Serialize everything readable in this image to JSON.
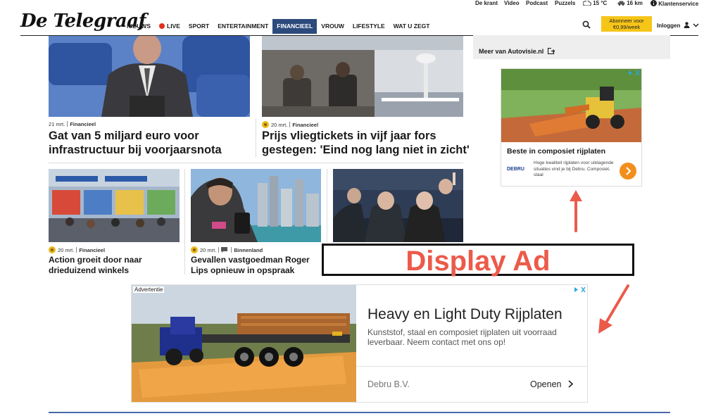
{
  "utility": {
    "items": [
      "De krant",
      "Video",
      "Podcast",
      "Puzzels"
    ],
    "weather": "15 °C",
    "traffic": "16 km",
    "service": "Klantenservice"
  },
  "header": {
    "logo": "De Telegraaf",
    "nav": [
      "NIEUWS",
      "LIVE",
      "SPORT",
      "ENTERTAINMENT",
      "FINANCIEEL",
      "VROUW",
      "LIFESTYLE",
      "WAT U ZEGT"
    ],
    "active_nav": "FINANCIEEL",
    "subscribe_line1": "Abonneer voor",
    "subscribe_line2": "€0,99/week",
    "login": "Inloggen"
  },
  "articles": [
    {
      "date": "21 mrt.",
      "category": "Financieel",
      "headline_1": "Gat van 5 miljard euro voor",
      "headline_2": "infrastructuur bij voorjaarsnota",
      "premium": false
    },
    {
      "date": "20 mrt.",
      "category": "Financieel",
      "headline_1": "Prijs vliegtickets in vijf jaar fors",
      "headline_2": "gestegen: 'Eind nog lang niet in zicht'",
      "premium": true
    },
    {
      "date": "20 mrt.",
      "category": "Financieel",
      "headline_1": "Action groeit door naar",
      "headline_2": "drieduizend winkels",
      "premium": true
    },
    {
      "date": "20 mrt.",
      "category": "Binnenland",
      "headline_1": "Gevallen vastgoedman Roger",
      "headline_2": "Lips opnieuw in opspraak",
      "premium": true,
      "has_comments": true
    }
  ],
  "sidebar": {
    "more_link": "Meer van Autovisie.nl",
    "ad": {
      "title": "Beste in composiet rijplaten",
      "brand": "DEBRU",
      "description": "Hoge kwaliteit rijplaten voor uitdagende situaties vind je bij Debru. Composiet, staal"
    }
  },
  "annotation": {
    "label": "Display Ad",
    "color": "#ec5a4a"
  },
  "banner_ad": {
    "label": "Advertentie",
    "title": "Heavy en Light Duty Rijplaten",
    "description": "Kunststof, staal en composiet rijplaten uit voorraad leverbaar. Neem contact met ons op!",
    "advertiser": "Debru B.V.",
    "cta": "Openen"
  },
  "colors": {
    "nav_active": "#2c4a7c",
    "subscribe": "#f5c518",
    "ad_arrow": "#f28e1c",
    "adchoices": "#2aa7df"
  }
}
